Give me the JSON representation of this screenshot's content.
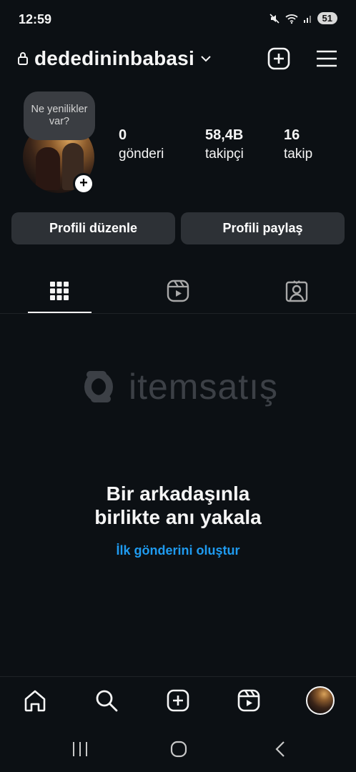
{
  "status_bar": {
    "time": "12:59",
    "battery": "51"
  },
  "header": {
    "username": "dededininbabasi"
  },
  "profile": {
    "note": "Ne yenilikler var?",
    "stats": [
      {
        "value": "0",
        "label": "gönderi"
      },
      {
        "value": "58,4B",
        "label": "takipçi"
      },
      {
        "value": "16",
        "label": "takip"
      }
    ]
  },
  "actions": {
    "edit_label": "Profili düzenle",
    "share_label": "Profili paylaş"
  },
  "tabs": [
    {
      "icon": "grid-icon",
      "selected": true
    },
    {
      "icon": "reels-icon",
      "selected": false
    },
    {
      "icon": "tagged-icon",
      "selected": false
    }
  ],
  "watermark": {
    "text": "itemsatış"
  },
  "empty_state": {
    "title_line1": "Bir arkadaşınla",
    "title_line2": "birlikte anı yakala",
    "link": "İlk gönderini oluştur"
  },
  "colors": {
    "background": "#0c1014",
    "button": "#2d3136",
    "link": "#1f9bf0"
  }
}
